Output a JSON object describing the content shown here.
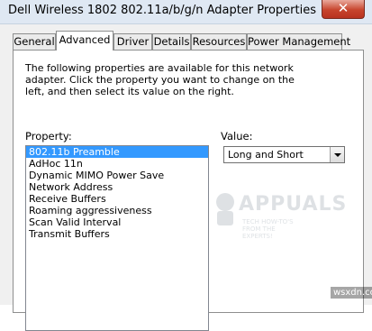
{
  "window": {
    "title": "Dell Wireless 1802 802.11a/b/g/n Adapter Properties",
    "close_glyph": "✕"
  },
  "tabs": [
    {
      "label": "General"
    },
    {
      "label": "Advanced"
    },
    {
      "label": "Driver"
    },
    {
      "label": "Details"
    },
    {
      "label": "Resources"
    },
    {
      "label": "Power Management"
    }
  ],
  "active_tab": "Advanced",
  "advanced": {
    "description": "The following properties are available for this network adapter. Click the property you want to change on the left, and then select its value on the right.",
    "property_label": "Property:",
    "properties": [
      {
        "label": "802.11b Preamble"
      },
      {
        "label": "AdHoc 11n"
      },
      {
        "label": "Dynamic MIMO Power Save"
      },
      {
        "label": "Network Address"
      },
      {
        "label": "Receive Buffers"
      },
      {
        "label": "Roaming aggressiveness"
      },
      {
        "label": "Scan Valid Interval"
      },
      {
        "label": "Transmit Buffers"
      }
    ],
    "selected_property": "802.11b Preamble",
    "value_label": "Value:",
    "value_selected": "Long and Short"
  },
  "watermark": {
    "brand": "APPUALS",
    "tagline": "TECH HOW-TO'S FROM THE EXPERTS!"
  },
  "site_badge": "wsxdn.com",
  "colors": {
    "selection": "#3399ff",
    "titlebar": "#dfe8f3",
    "close_button": "#c7442d"
  }
}
